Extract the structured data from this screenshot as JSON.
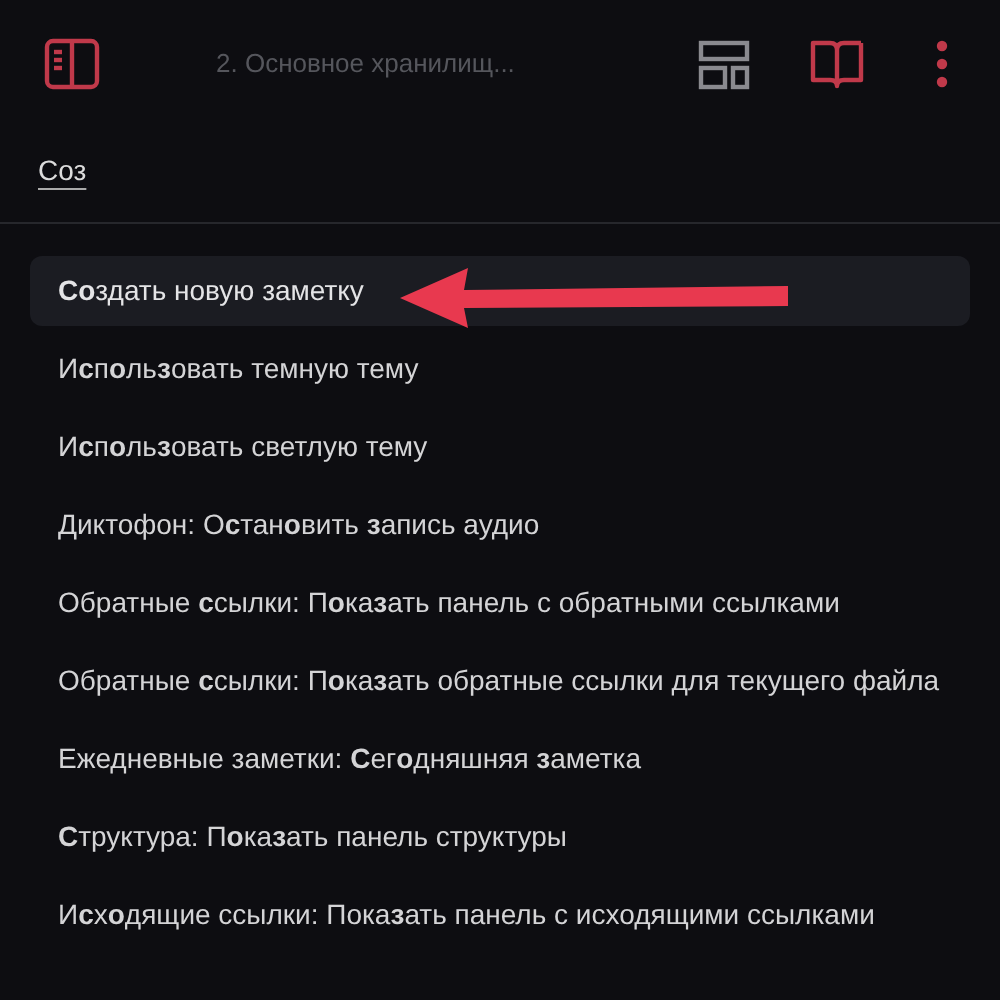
{
  "header": {
    "title": "2. Основное хранилищ..."
  },
  "search": {
    "value": "Соз"
  },
  "commands": [
    {
      "label": "**Со**здать новую заметку",
      "selected": true
    },
    {
      "label": "И**с**п**о**ль**з**овать темную тему",
      "selected": false
    },
    {
      "label": "И**с**п**о**ль**з**овать светлую тему",
      "selected": false
    },
    {
      "label": "Диктофон: О**с**тан**о**вить **з**апись аудио",
      "selected": false
    },
    {
      "label": "Обратные **с**сылки: П**о**ка**з**ать панель с обратными ссылками",
      "selected": false
    },
    {
      "label": "Обратные **с**сылки: П**о**ка**з**ать обратные ссылки для текущего файла",
      "selected": false
    },
    {
      "label": "Ежедневные заметки: **С**ег**о**дняшняя **з**аметка",
      "selected": false
    },
    {
      "label": "**С**труктура: П**о**ка**з**ать панель структуры",
      "selected": false
    },
    {
      "label": "И**с**х**о**дящие ссылки: Пока**з**ать панель с исходящими ссылками",
      "selected": false
    }
  ]
}
